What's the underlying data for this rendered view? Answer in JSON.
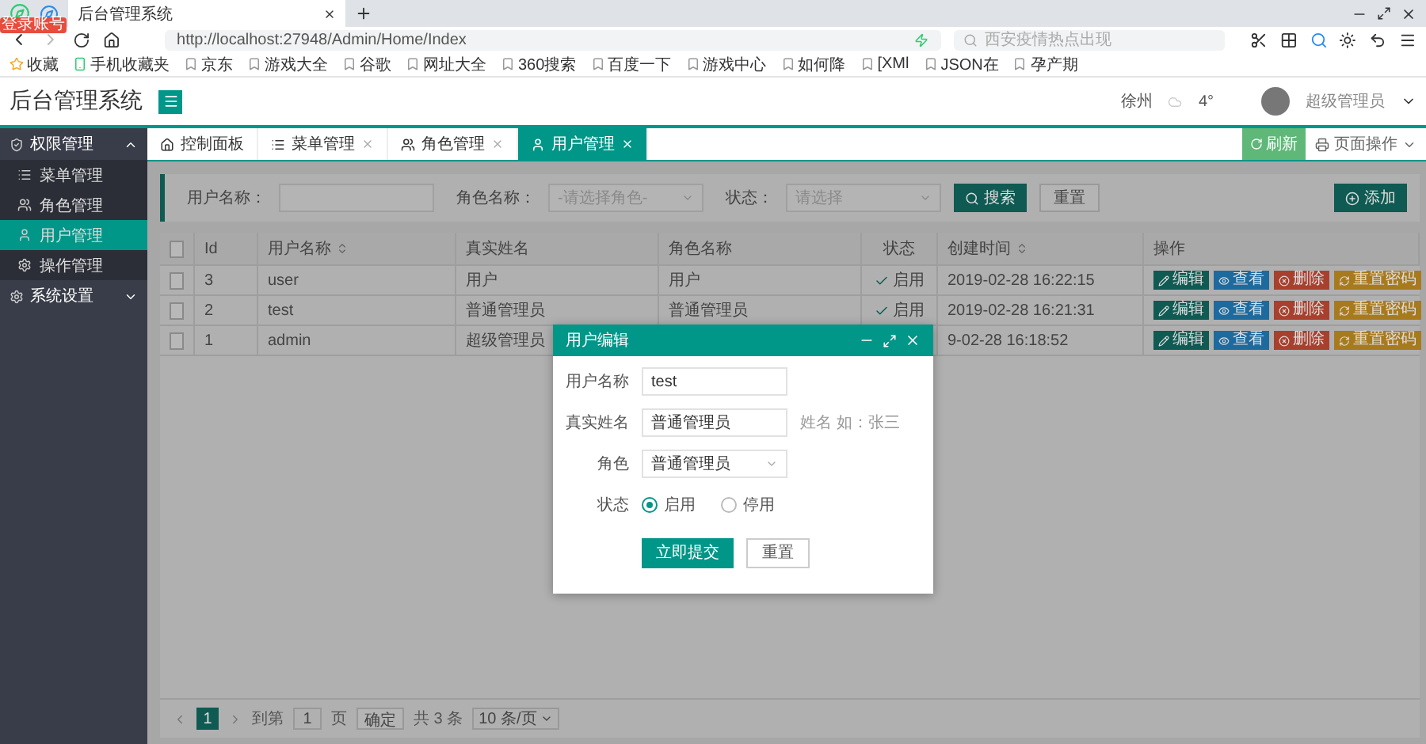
{
  "browser": {
    "badge": "登录账号",
    "tab": {
      "title": "后台管理系统",
      "selected": true
    },
    "url": "http://localhost:27948/Admin/Home/Index",
    "search": {
      "placeholder": "西安疫情热点出现"
    },
    "bookmarks": [
      {
        "label": "收藏"
      },
      {
        "label": "手机收藏夹"
      },
      {
        "label": "京东"
      },
      {
        "label": "游戏大全"
      },
      {
        "label": "谷歌"
      },
      {
        "label": "网址大全"
      },
      {
        "label": "360搜索"
      },
      {
        "label": "百度一下"
      },
      {
        "label": "游戏中心"
      },
      {
        "label": "如何降"
      },
      {
        "label": "[XMl"
      },
      {
        "label": "JSON在"
      },
      {
        "label": "孕产期"
      }
    ]
  },
  "header": {
    "title": "后台管理系统",
    "city": "徐州",
    "temperature": "4°",
    "user": "超级管理员"
  },
  "sidebar": {
    "items": [
      {
        "label": "权限管理",
        "kind": "group",
        "expanded": true,
        "children": [
          {
            "label": "菜单管理",
            "kind": "menu",
            "selected": false
          },
          {
            "label": "角色管理",
            "kind": "role",
            "selected": false
          },
          {
            "label": "用户管理",
            "kind": "user",
            "selected": true
          },
          {
            "label": "操作管理",
            "kind": "action",
            "selected": false
          }
        ]
      },
      {
        "label": "系统设置",
        "kind": "settings",
        "expanded": false
      }
    ]
  },
  "tabs": [
    {
      "label": "控制面板",
      "kind": "home",
      "closable": false,
      "selected": false
    },
    {
      "label": "菜单管理",
      "kind": "menu",
      "closable": true,
      "selected": false
    },
    {
      "label": "角色管理",
      "kind": "role",
      "closable": true,
      "selected": false
    },
    {
      "label": "用户管理",
      "kind": "user",
      "closable": true,
      "selected": true
    }
  ],
  "toolbar": {
    "refresh": "刷新",
    "page_actions": "页面操作"
  },
  "search_form": {
    "fields": [
      {
        "label": "用户名称：",
        "kind": "input"
      },
      {
        "label": "角色名称：",
        "kind": "select",
        "placeholder": "-请选择角色-"
      },
      {
        "label": "状态：",
        "kind": "select",
        "placeholder": "请选择"
      }
    ],
    "search": "搜索",
    "reset": "重置",
    "add": "添加"
  },
  "table": {
    "all_checked": false,
    "columns": [
      {
        "label": "Id",
        "sortable": false
      },
      {
        "label": "用户名称",
        "sortable": true
      },
      {
        "label": "真实姓名",
        "sortable": false
      },
      {
        "label": "角色名称",
        "sortable": false
      },
      {
        "label": "状态",
        "sortable": false
      },
      {
        "label": "创建时间",
        "sortable": true
      },
      {
        "label": "操作",
        "sortable": false
      }
    ],
    "rows": [
      {
        "checked": false,
        "id": "3",
        "username": "user",
        "realname": "用户",
        "role": "用户",
        "status": "启用",
        "created": "2019-02-28 16:22:15",
        "actions": [
          {
            "label": "编辑",
            "kind": "edit"
          },
          {
            "label": "查看",
            "kind": "view"
          },
          {
            "label": "删除",
            "kind": "delete"
          },
          {
            "label": "重置密码",
            "kind": "reset"
          }
        ]
      },
      {
        "checked": false,
        "id": "2",
        "username": "test",
        "realname": "普通管理员",
        "role": "普通管理员",
        "status": "启用",
        "created": "2019-02-28 16:21:31",
        "actions": [
          {
            "label": "编辑",
            "kind": "edit"
          },
          {
            "label": "查看",
            "kind": "view"
          },
          {
            "label": "删除",
            "kind": "delete"
          },
          {
            "label": "重置密码",
            "kind": "reset"
          }
        ]
      },
      {
        "checked": false,
        "id": "1",
        "username": "admin",
        "realname": "超级管理员",
        "created": "9-02-28 16:18:52",
        "actions": [
          {
            "label": "编辑",
            "kind": "edit"
          },
          {
            "label": "查看",
            "kind": "view"
          },
          {
            "label": "删除",
            "kind": "delete"
          },
          {
            "label": "重置密码",
            "kind": "reset"
          }
        ]
      }
    ]
  },
  "pagination": {
    "pages": [
      {
        "label": "1",
        "selected": true
      }
    ],
    "goto_label": "到第",
    "goto_value": "1",
    "page_unit": "页",
    "confirm": "确定",
    "total": "共 3 条",
    "page_size": "10 条/页"
  },
  "modal": {
    "title": "用户编辑",
    "fields": [
      {
        "label": "用户名称",
        "kind": "input",
        "value": "test"
      },
      {
        "label": "真实姓名",
        "kind": "input",
        "value": "普通管理员",
        "hint": "姓名 如：张三"
      },
      {
        "label": "角色",
        "kind": "select",
        "value": "普通管理员"
      },
      {
        "label": "状态",
        "kind": "radio",
        "options": [
          {
            "label": "启用",
            "selected": true
          },
          {
            "label": "停用",
            "selected": false
          }
        ]
      }
    ],
    "submit": "立即提交",
    "reset": "重置"
  }
}
